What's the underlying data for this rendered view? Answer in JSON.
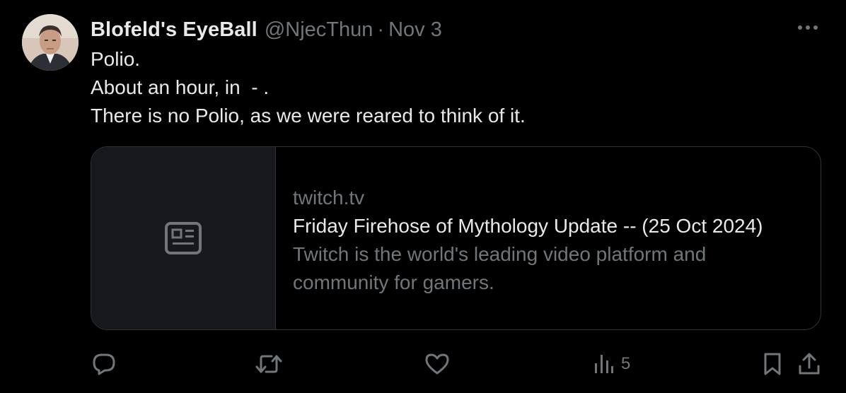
{
  "author": {
    "display_name": "Blofeld's EyeBall",
    "handle": "@NjecThun",
    "separator": "·",
    "date": "Nov 3"
  },
  "tweet": {
    "lines": [
      "Polio.",
      "About an hour, in  - .",
      "There is no Polio, as we were reared to think of it."
    ]
  },
  "card": {
    "thumbnail_icon": "news-article-icon",
    "domain": "twitch.tv",
    "title": "Friday Firehose of Mythology Update -- (25 Oct 2024)",
    "description": "Twitch is the world's leading video platform and community for gamers."
  },
  "actions": {
    "reply_icon": "reply-icon",
    "retweet_icon": "retweet-icon",
    "like_icon": "heart-icon",
    "views_icon": "analytics-icon",
    "views_count": "5",
    "bookmark_icon": "bookmark-icon",
    "share_icon": "share-icon"
  },
  "colors": {
    "background": "#000000",
    "primary_text": "#e7e9ea",
    "secondary_text": "#71767b",
    "border": "#2f3336",
    "card_thumb_bg": "#16181c"
  }
}
